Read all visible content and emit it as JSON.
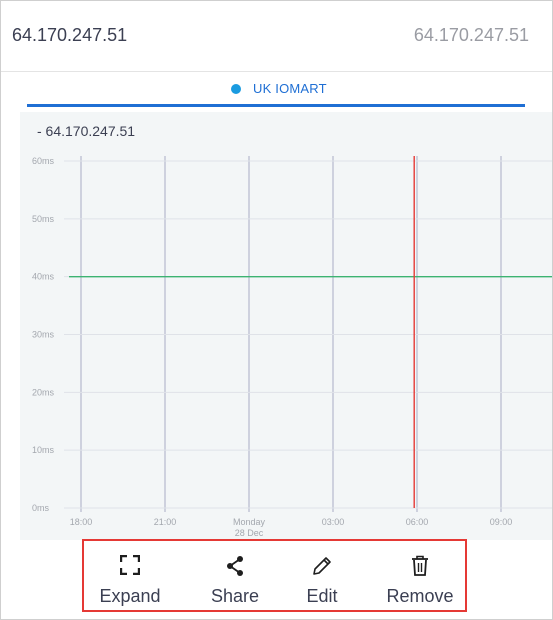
{
  "header": {
    "left_ip": "64.170.247.51",
    "right_ip": "64.170.247.51"
  },
  "tab": {
    "label": "UK IOMART",
    "dot_color": "#1a9be0",
    "underline_color": "#1f6fd4"
  },
  "chart_data": {
    "type": "line",
    "title": "- 64.170.247.51",
    "xlabel": "",
    "ylabel": "",
    "y_ticks": [
      "60ms",
      "50ms",
      "40ms",
      "30ms",
      "20ms",
      "10ms",
      "0ms"
    ],
    "ylim": [
      0,
      60
    ],
    "x_ticks": [
      "18:00",
      "21:00",
      "Monday",
      "03:00",
      "06:00",
      "09:00"
    ],
    "x_tick_sublabel": "28 Dec",
    "grid": true,
    "series": [
      {
        "color": "#3cb371",
        "x_hours": [
          0,
          6,
          12,
          17.5
        ],
        "values": [
          40,
          40,
          40,
          40
        ]
      }
    ],
    "marker": {
      "color": "#e53935",
      "x_hours": 11.9
    }
  },
  "actions": {
    "expand_label": "Expand",
    "share_label": "Share",
    "edit_label": "Edit",
    "remove_label": "Remove",
    "highlight_color": "#e53935"
  }
}
